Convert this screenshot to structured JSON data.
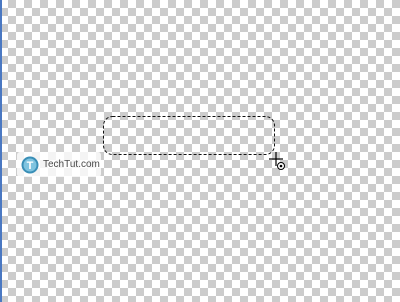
{
  "canvas": {
    "background": "transparent-checkerboard",
    "checker_colors": [
      "#ffffff",
      "#cccccc"
    ]
  },
  "selection": {
    "shape": "rounded-rectangle",
    "style": "marching-ants"
  },
  "cursor": {
    "icon": "crosshair-plus-cursor-icon"
  },
  "watermark": {
    "text": "TechTut.com",
    "logo_letter": "T",
    "logo_color": "#3a8fb7"
  }
}
